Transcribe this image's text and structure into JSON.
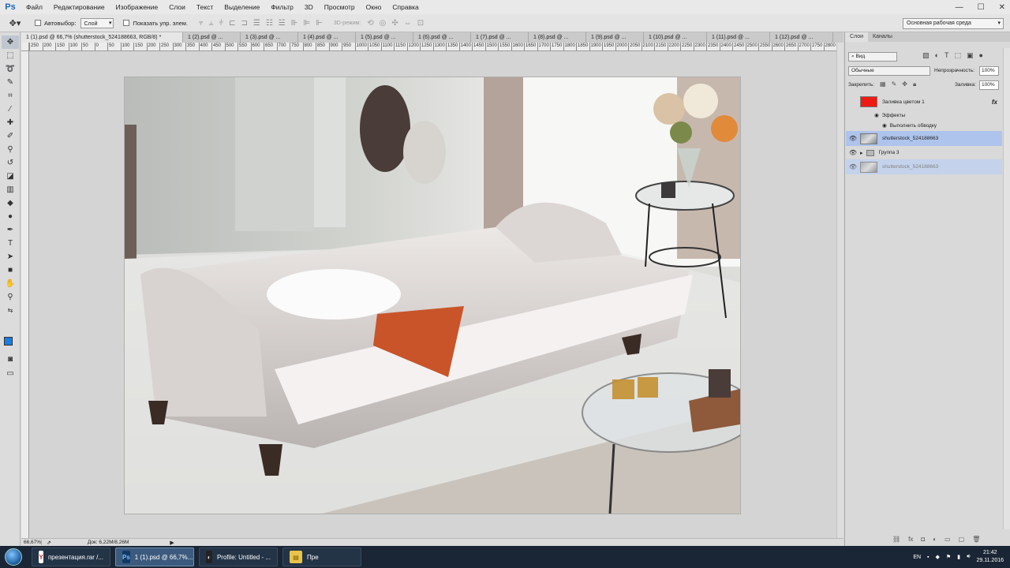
{
  "menubar": {
    "logo": "Ps",
    "items": [
      "Файл",
      "Редактирование",
      "Изображение",
      "Слои",
      "Текст",
      "Выделение",
      "Фильтр",
      "3D",
      "Просмотр",
      "Окно",
      "Справка"
    ],
    "window_controls": [
      "—",
      "☐",
      "✕"
    ]
  },
  "options": {
    "tool_icon": "move-tool-icon",
    "auto_select_label": "Автовыбор:",
    "auto_select_value": "Слой",
    "show_controls_label": "Показать упр. элем.",
    "mode_3d_label": "3D-режим:",
    "workspace": "Основная рабочая среда"
  },
  "doc_tabs": [
    "1 (1).psd @ 66,7% (shutterstock_524188663, RGB/8) *",
    "1 (2).psd @ ...",
    "1 (3).psd @ ...",
    "1 (4).psd @ ...",
    "1 (5).psd @ ...",
    "1 (6).psd @ ...",
    "1 (7).psd @ ...",
    "1 (8).psd @ ...",
    "1 (9).psd @ ...",
    "1 (10).psd @ ...",
    "1 (11).psd @ ...",
    "1 (12).psd @ ..."
  ],
  "ruler_ticks": [
    "250",
    "200",
    "150",
    "100",
    "50",
    "0",
    "50",
    "100",
    "150",
    "200",
    "250",
    "300",
    "350",
    "400",
    "450",
    "500",
    "550",
    "600",
    "650",
    "700",
    "750",
    "800",
    "850",
    "900",
    "950",
    "1000",
    "1050",
    "1100",
    "1150",
    "1200",
    "1250",
    "1300",
    "1350",
    "1400",
    "1450",
    "1500",
    "1550",
    "1600",
    "1650",
    "1700",
    "1750",
    "1800",
    "1850",
    "1900",
    "1950",
    "2000",
    "2050",
    "2100",
    "2150",
    "2200",
    "2250",
    "2300",
    "2350",
    "2400",
    "2450",
    "2500",
    "2550",
    "2600",
    "2650",
    "2700",
    "2750",
    "2800"
  ],
  "status": {
    "zoom": "66,67%",
    "doc_size": "Док: 6,22M/8,26M",
    "arrow": "▶"
  },
  "layers_panel": {
    "tabs": [
      "Слои",
      "Каналы"
    ],
    "filter_label": "Вид",
    "blend_mode": "Обычные",
    "opacity_label": "Непрозрачность:",
    "opacity_value": "100%",
    "lock_label": "Закрепить:",
    "fill_label": "Заливка:",
    "fill_value": "100%",
    "fill_layer": "Заливка цветом 1",
    "effects_label": "Эффекты",
    "stroke_effect": "Выполнить обводку",
    "fx_badge": "fx",
    "layer_photo": "shutterstock_524188663",
    "group": "Группа 3",
    "layer_dragging": "shutterstock_524188663"
  },
  "taskbar": {
    "tasks": [
      {
        "label": "презентация.rar /...",
        "icon": "Y",
        "color": "#d22"
      },
      {
        "label": "1 (1).psd @ 66,7%...",
        "icon": "Ps",
        "color": "#0f3a66"
      },
      {
        "label": "Profile: Untitled - ...",
        "icon": "◐",
        "color": "#222"
      },
      {
        "label": "Пре",
        "icon": "▤",
        "color": "#e8c44a"
      }
    ],
    "lang": "EN",
    "time": "21:42",
    "date": "29.11.2016"
  },
  "colors": {
    "fill_layer_color": "#ee1b14",
    "foreground": "#1a7de0",
    "selection": "#aec4ec"
  }
}
